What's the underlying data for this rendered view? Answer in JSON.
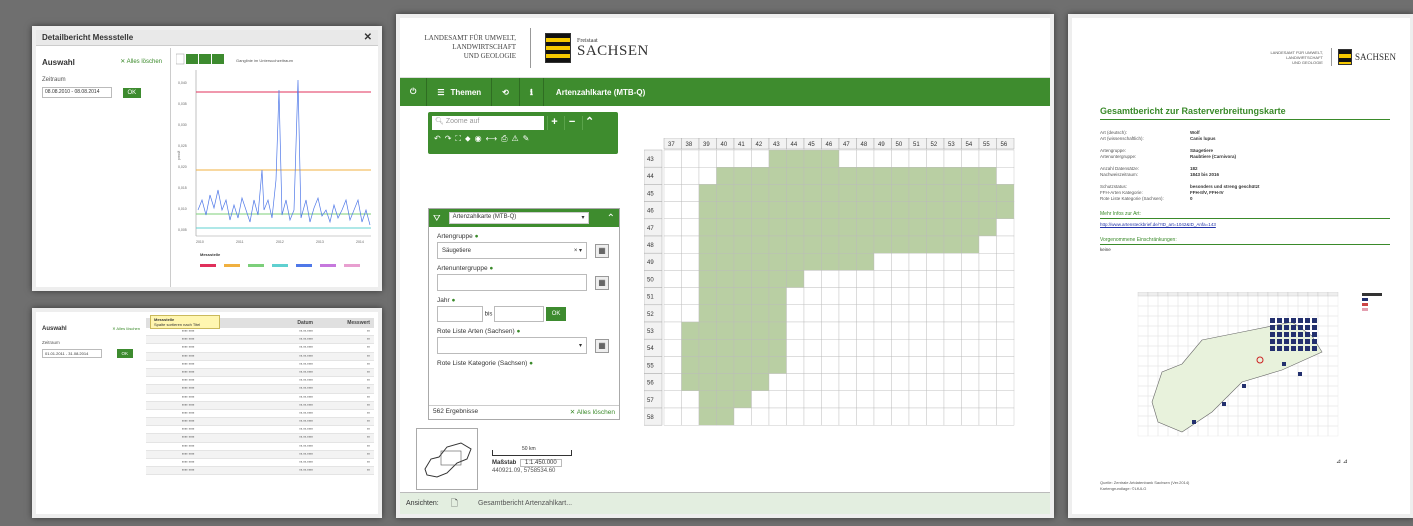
{
  "panel_detail": {
    "title": "Detailbericht Messstelle",
    "auswahl": "Auswahl",
    "alles_loeschen": "✕ Alles löschen",
    "zeitraum": "Zeitraum",
    "date_range": "08.08.2010 - 08.08.2014",
    "ok": "OK",
    "chart_title": "Ganglinie im Untersuchzeitraum",
    "legend_title": "Messstelle",
    "ylabel": "pmol/l",
    "y_ticks": [
      "0,040",
      "0,035",
      "0,030",
      "0,025",
      "0,020",
      "0,015",
      "0,010",
      "0,005"
    ],
    "x_ticks": [
      "2010",
      "2011",
      "2012",
      "2013",
      "2014"
    ]
  },
  "panel_table": {
    "auswahl": "Auswahl",
    "alles_loeschen": "✕ Alles löschen",
    "zeitraum": "Zeitraum",
    "date_range": "01.01.2011 - 31.08.2014",
    "ok": "OK",
    "tooltip_title": "Messstelle",
    "tooltip_body": "Spalte sortieren nach Titel",
    "col1": "Messstelle",
    "col2": "Datum",
    "col3": "Messwert",
    "rows": 18
  },
  "panel_map": {
    "lfulg": [
      "LANDESAMT FÜR UMWELT,",
      "LANDWIRTSCHAFT",
      "UND GEOLOGIE"
    ],
    "freistaat": "Freistaat",
    "sachsen": "SACHSEN",
    "toolbar_themen": "Themen",
    "toolbar_title": "Artenzahlkarte (MTB-Q)",
    "search_placeholder": "Zoome auf",
    "filter_select": "Artenzahlkarte (MTB-Q)",
    "artengruppe": "Artengruppe",
    "artengruppe_value": "Säugetiere",
    "artenuntergruppe": "Artenuntergruppe",
    "jahr": "Jahr",
    "bis": "bis",
    "ok": "OK",
    "rote_liste_arten": "Rote Liste Arten (Sachsen)",
    "rote_liste_kategorie": "Rote Liste Kategorie (Sachsen)",
    "ergebnisse": "562 Ergebnisse",
    "alles_loeschen": "✕ Alles löschen",
    "cols": [
      "37",
      "38",
      "39",
      "40",
      "41",
      "42",
      "43",
      "44",
      "45",
      "46",
      "47",
      "48",
      "49",
      "50",
      "51",
      "52",
      "53",
      "54",
      "55",
      "56"
    ],
    "rows": [
      "43",
      "44",
      "45",
      "46",
      "47",
      "48",
      "49",
      "50",
      "51",
      "52",
      "53",
      "54",
      "55",
      "56",
      "57",
      "58"
    ],
    "scale_label": "50 km",
    "massstab_label": "Maßstab",
    "massstab_value": "1:1.450.000",
    "coords": "440921.09, 5758534.60",
    "ansichten": "Ansichten:",
    "tab_label": "Gesamtbericht Artenzahlkart..."
  },
  "panel_report": {
    "lfulg": [
      "LANDESAMT FÜR UMWELT,",
      "LANDWIRTSCHAFT",
      "UND GEOLOGIE"
    ],
    "sachsen": "SACHSEN",
    "title": "Gesamtbericht zur Rasterverbreitungskarte",
    "rows": [
      [
        "Art (deutsch):",
        "Wolf"
      ],
      [
        "Art (wissenschaftlich):",
        "Canis lupus"
      ],
      [
        "",
        ""
      ],
      [
        "Artengruppe:",
        "Säugetiere"
      ],
      [
        "Artenuntergruppe:",
        "Raubtiere (Carnivora)"
      ],
      [
        "",
        ""
      ],
      [
        "Anzahl Datensätze:",
        "182"
      ],
      [
        "Nachweiszeitraum:",
        "1843 bis 2016"
      ],
      [
        "",
        ""
      ],
      [
        "Schutzstatus:",
        "besonders und streng geschützt"
      ],
      [
        "FFH-Arten Kategorie:",
        "FFH-II/V, FFH-IV"
      ],
      [
        "Rote Liste Kategorie (Sachsen):",
        "0"
      ]
    ],
    "more_info": "Mehr Infos zur Art:",
    "link": "http://www.artensteckbrief.de/?ID_art=1042&ID_Anfa=143",
    "restrictions": "Vorgenommene Einschränkungen:",
    "restrictions_value": "keine",
    "source": "Quelle: Zentrale Artdatenbank Sachsen (Ver.2014)",
    "basis": "Kartengrundlage: ©LfULG"
  }
}
